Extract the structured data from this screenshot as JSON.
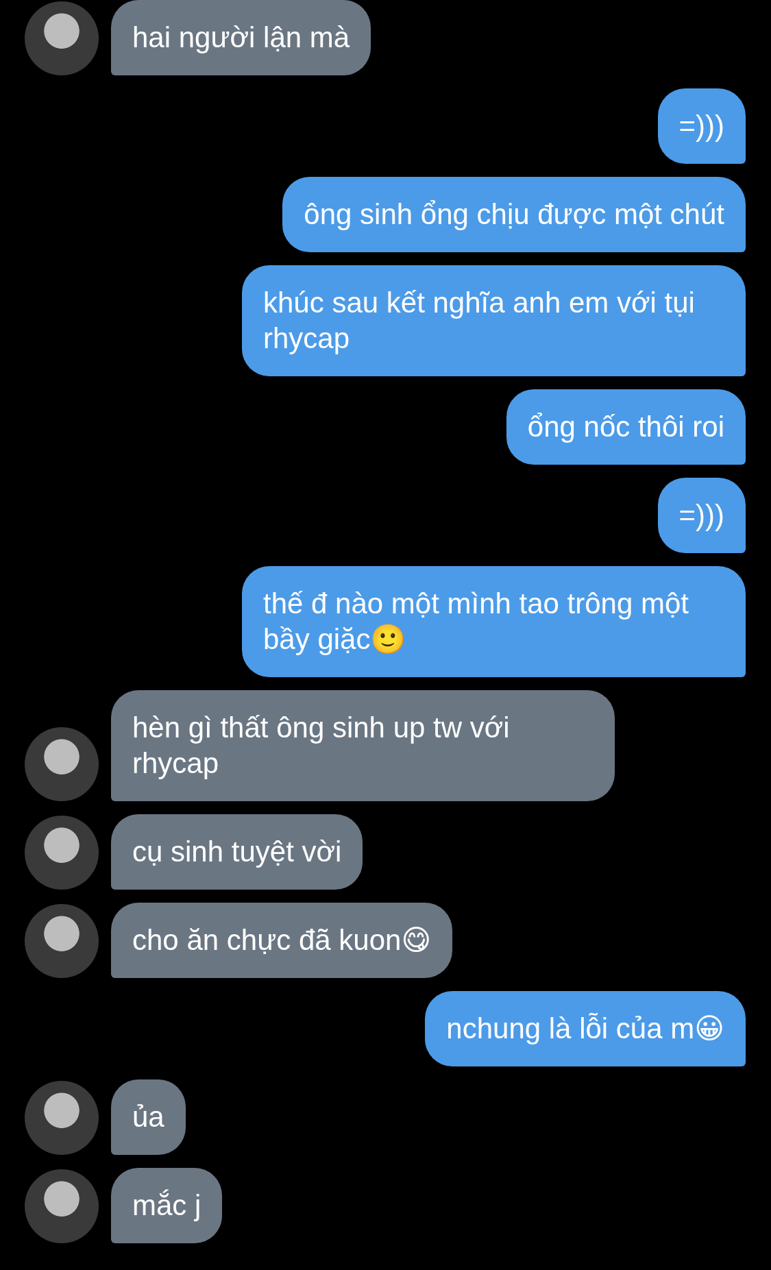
{
  "messages": [
    {
      "kind": "received",
      "text": "hai người lận mà"
    },
    {
      "kind": "sent",
      "text": "=)))"
    },
    {
      "kind": "sent",
      "text": "ông sinh ổng chịu được một chút"
    },
    {
      "kind": "sent",
      "text": "khúc sau kết nghĩa anh em với tụi rhycap"
    },
    {
      "kind": "sent",
      "text": "ổng nốc thôi roi"
    },
    {
      "kind": "sent",
      "text": "=)))"
    },
    {
      "kind": "sent",
      "text": "thế đ nào một mình tao trông một bầy giặc🙂"
    },
    {
      "kind": "received",
      "text": "hèn gì thất ông sinh up tw với rhycap"
    },
    {
      "kind": "received",
      "text": "cụ sinh tuyệt vời"
    },
    {
      "kind": "received",
      "text": "cho ăn chực đã kuon😋"
    },
    {
      "kind": "sent",
      "text": "nchung là lỗi của m😀"
    },
    {
      "kind": "received",
      "text": "ủa"
    },
    {
      "kind": "received",
      "text": "mắc j"
    }
  ]
}
